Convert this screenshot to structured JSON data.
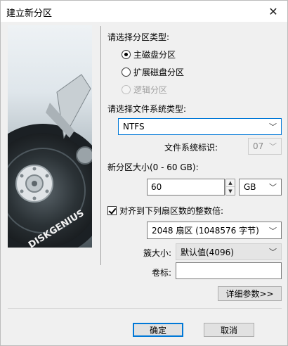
{
  "window": {
    "title": "建立新分区",
    "close_glyph": "✕"
  },
  "banner": {
    "brand_text": "DISKGENIUS"
  },
  "partition_type": {
    "label": "请选择分区类型:",
    "options": [
      {
        "label": "主磁盘分区",
        "checked": true,
        "disabled": false
      },
      {
        "label": "扩展磁盘分区",
        "checked": false,
        "disabled": false
      },
      {
        "label": "逻辑分区",
        "checked": false,
        "disabled": true
      }
    ]
  },
  "filesystem": {
    "label": "请选择文件系统类型:",
    "value": "NTFS",
    "id_label": "文件系统标识:",
    "id_value": "07"
  },
  "size": {
    "label": "新分区大小(0 - 60 GB):",
    "value": "60",
    "unit": "GB"
  },
  "align": {
    "checkbox_label": "对齐到下列扇区数的整数倍:",
    "checked": true,
    "value": "2048 扇区 (1048576 字节)"
  },
  "cluster": {
    "label": "簇大小:",
    "value": "默认值(4096)"
  },
  "volume": {
    "label": "卷标:",
    "value": ""
  },
  "buttons": {
    "advanced": "详细参数>>",
    "ok": "确定",
    "cancel": "取消"
  },
  "icons": {
    "dropdown": "chevron-down-icon",
    "spin_up": "▲",
    "spin_down": "▼"
  }
}
